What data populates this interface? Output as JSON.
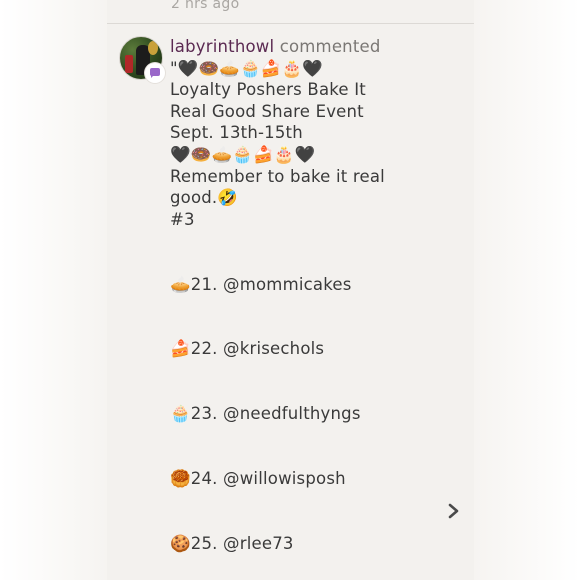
{
  "previous": {
    "timestamp": "2 hrs ago"
  },
  "comment": {
    "username": "labyrinthowl",
    "action": "commented",
    "lines": [
      "\"🖤🍩🥧🧁🍰🎂🖤",
      "Loyalty Poshers Bake It",
      "Real Good Share Event",
      "Sept. 13th-15th",
      "🖤🍩🥧🧁🍰🎂🖤",
      "Remember to bake it real",
      "good.🤣",
      "#3",
      "",
      "",
      "🥧21. @mommicakes",
      "",
      "",
      "🍰22. @krisechols",
      "",
      "",
      "🧁23. @needfulthyngs",
      "",
      "",
      "🥮24. @willowisposh",
      "",
      "",
      "🍪25. @rlee73"
    ]
  },
  "icons": {
    "avatar": "user-avatar",
    "comment_badge": "comment-bubble-icon",
    "next": "chevron-right-icon"
  },
  "colors": {
    "username": "#5b2a52",
    "badge": "#9a68c9",
    "panel": "#f3f1ee"
  }
}
